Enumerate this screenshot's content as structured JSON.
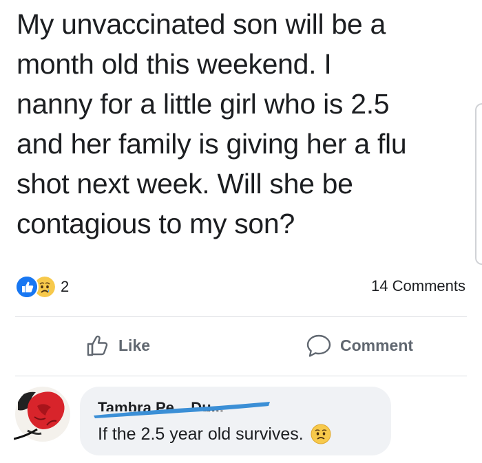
{
  "post": {
    "text_lines": [
      "My unvaccinated son will be a",
      "month old this weekend. I",
      "nanny for a little girl who is 2.5",
      "and her family is giving her a flu",
      "shot next week. Will she be",
      "contagious to my son?"
    ]
  },
  "reactions": {
    "icons": [
      "like-icon",
      "sad-icon"
    ],
    "count": "2"
  },
  "comments_summary": "14 Comments",
  "actions": {
    "like_label": "Like",
    "like_icon": "thumbs-up-icon",
    "comment_label": "Comment",
    "comment_icon": "speech-bubble-icon"
  },
  "comment": {
    "author_name": "Tambra Pe... Du...",
    "text": "If the 2.5 year old survives.",
    "emoji_icon": "sad-face-icon"
  },
  "colors": {
    "text": "#1c1e21",
    "muted": "#606770",
    "brand_blue": "#1877f2",
    "bubble_bg": "#f0f2f5",
    "divider": "#dadde1",
    "emoji_yellow": "#f7c94b",
    "scribble_blue": "#3b8fd6"
  }
}
